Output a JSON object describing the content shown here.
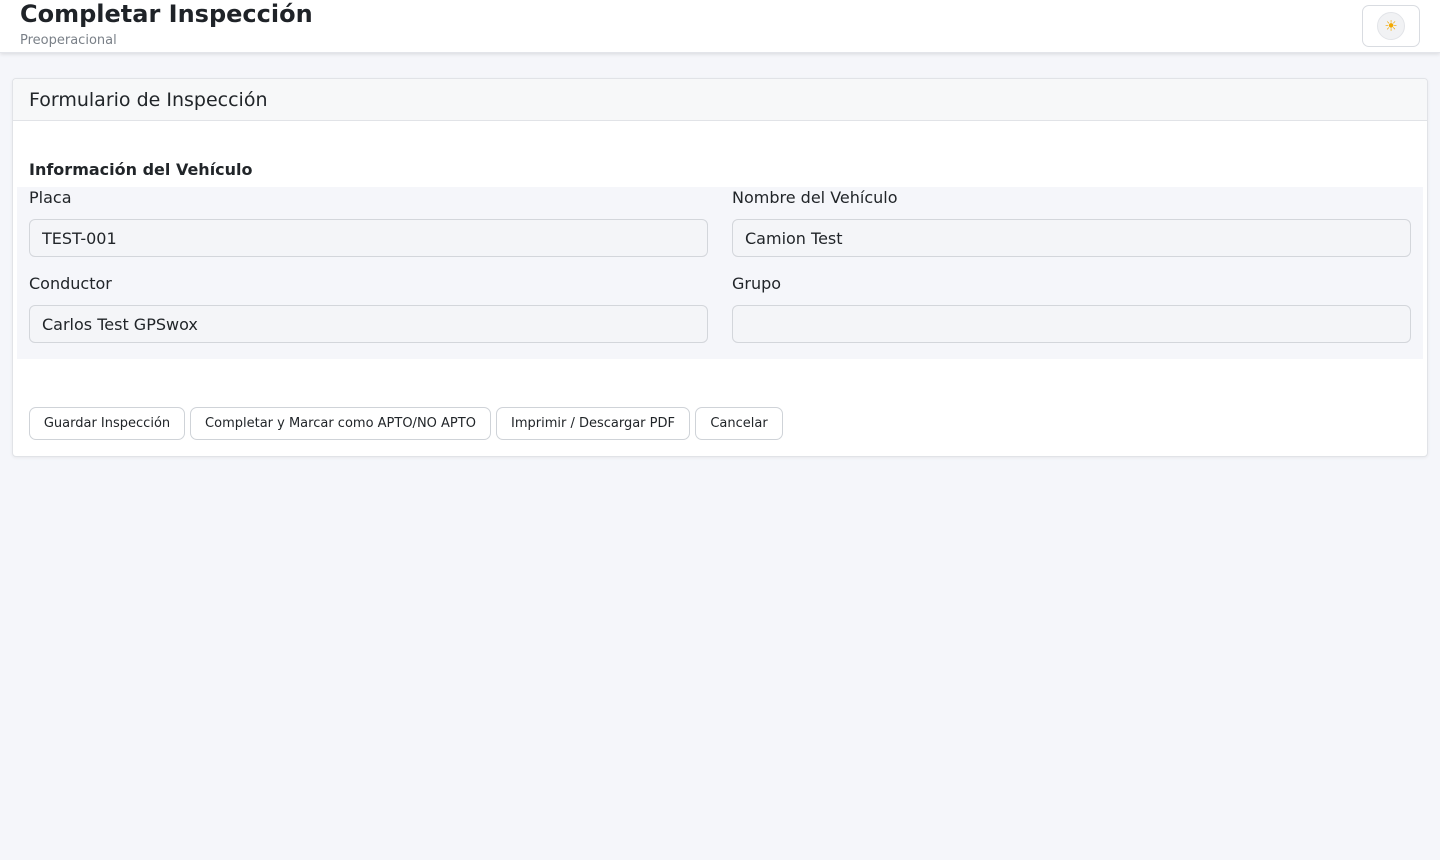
{
  "header": {
    "title": "Completar Inspección",
    "subtitle": "Preoperacional",
    "theme_toggle_icon": "sun-icon",
    "theme_toggle_glyph": "☀"
  },
  "card": {
    "title": "Formulario de Inspección"
  },
  "vehicle_section": {
    "title": "Información del Vehículo",
    "fields": {
      "placa": {
        "label": "Placa",
        "value": "TEST-001"
      },
      "nombre": {
        "label": "Nombre del Vehículo",
        "value": "Camion Test"
      },
      "conductor": {
        "label": "Conductor",
        "value": "Carlos Test GPSwox"
      },
      "grupo": {
        "label": "Grupo",
        "value": ""
      }
    }
  },
  "actions": {
    "save": "Guardar Inspección",
    "complete": "Completar y Marcar como APTO/NO APTO",
    "print": "Imprimir / Descargar PDF",
    "cancel": "Cancelar"
  },
  "colors": {
    "page_background": "#f5f6fa",
    "accent_sun": "#f2a900"
  }
}
